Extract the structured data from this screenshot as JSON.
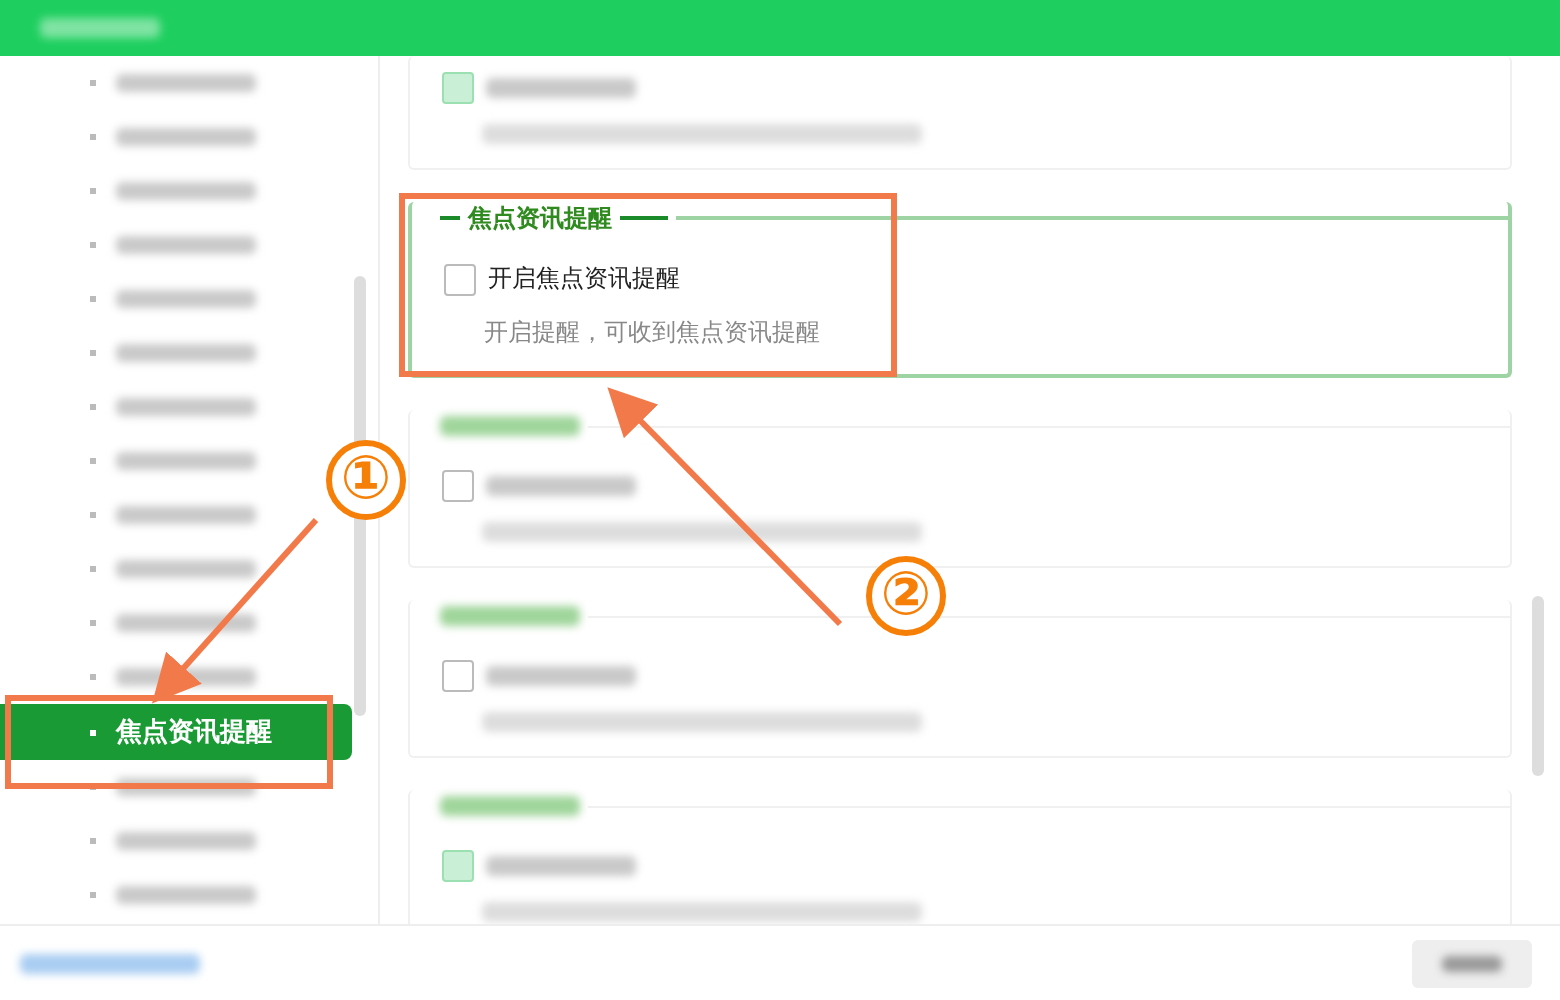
{
  "sidebar": {
    "items": [
      {
        "selected": false
      },
      {
        "selected": false
      },
      {
        "selected": false
      },
      {
        "selected": false
      },
      {
        "selected": false
      },
      {
        "selected": false
      },
      {
        "selected": false
      },
      {
        "selected": false
      },
      {
        "selected": false
      },
      {
        "selected": false
      },
      {
        "selected": false
      },
      {
        "selected": false
      },
      {
        "label": "焦点资讯提醒",
        "selected": true
      },
      {
        "selected": false
      },
      {
        "selected": false
      },
      {
        "selected": false
      }
    ]
  },
  "sections": [
    {
      "kind": "blurred",
      "checked": true,
      "highlighted": false
    },
    {
      "kind": "clear",
      "title": "焦点资讯提醒",
      "option": "开启焦点资讯提醒",
      "description": "开启提醒，可收到焦点资讯提醒",
      "checked": false,
      "highlighted": true
    },
    {
      "kind": "blurred",
      "checked": false,
      "highlighted": false
    },
    {
      "kind": "blurred",
      "checked": false,
      "highlighted": false
    },
    {
      "kind": "blurred",
      "checked": true,
      "highlighted": false
    }
  ],
  "annotations": [
    {
      "label": "①"
    },
    {
      "label": "②"
    }
  ]
}
